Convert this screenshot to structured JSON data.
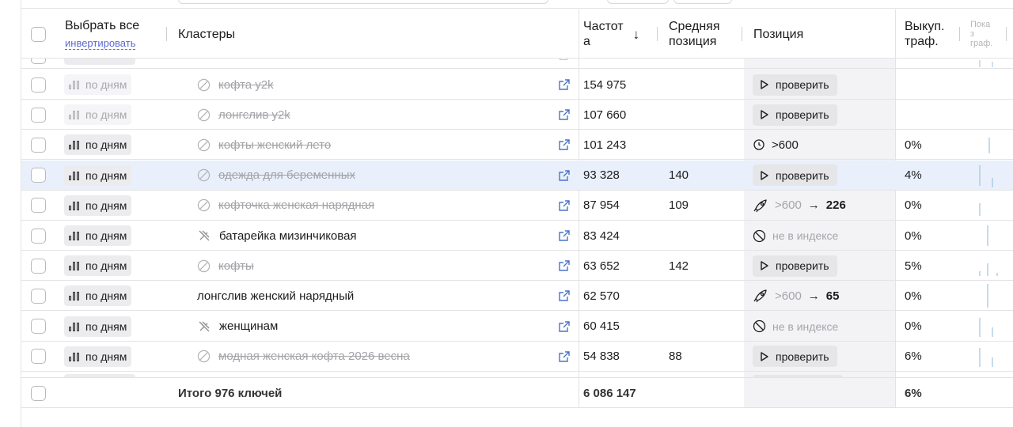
{
  "header": {
    "select_all": "Выбрать все",
    "invert": "инвертировать",
    "clusters": "Кластеры",
    "frequency_line1": "Частот",
    "frequency_line2": "а",
    "avg_position_line1": "Средняя",
    "avg_position_line2": "позиция",
    "position": "Позиция",
    "buyout_line1": "Выкуп.",
    "buyout_line2": "траф.",
    "shows_line1": "Пока",
    "shows_line2": "з",
    "shows_line3": "граф."
  },
  "days_label": "по дням",
  "check_label": "проверить",
  "rows": [
    {
      "keyword": "кофта y2k",
      "status": "excluded",
      "frequency": "154 975",
      "avg_position": "",
      "position_type": "check",
      "buyout": "",
      "faded_days": true,
      "selected": false
    },
    {
      "keyword": "лонгслив y2k",
      "status": "excluded",
      "frequency": "107 660",
      "avg_position": "",
      "position_type": "check",
      "buyout": "",
      "faded_days": true,
      "selected": false
    },
    {
      "keyword": "кофты женский лето",
      "status": "excluded",
      "frequency": "101 243",
      "avg_position": "",
      "position_type": "timer",
      "position_value": ">600",
      "buyout": "0%",
      "faded_days": false,
      "selected": false
    },
    {
      "keyword": "одежда для беременных",
      "status": "excluded",
      "frequency": "93 328",
      "avg_position": "140",
      "position_type": "check",
      "buyout": "4%",
      "faded_days": false,
      "selected": true
    },
    {
      "keyword": "кофточка женская нарядная",
      "status": "excluded",
      "frequency": "87 954",
      "avg_position": "109",
      "position_type": "rocket",
      "position_from": ">600",
      "position_to": "226",
      "buyout": "0%",
      "faded_days": false,
      "selected": false
    },
    {
      "keyword": "батарейка мизинчиковая",
      "status": "unpinned",
      "frequency": "83 424",
      "avg_position": "",
      "position_type": "noindex",
      "position_value": "не в индексе",
      "buyout": "0%",
      "faded_days": false,
      "selected": false
    },
    {
      "keyword": "кофты",
      "status": "excluded",
      "frequency": "63 652",
      "avg_position": "142",
      "position_type": "check",
      "buyout": "5%",
      "faded_days": false,
      "selected": false
    },
    {
      "keyword": "лонгслив женский нарядный",
      "status": "normal",
      "frequency": "62 570",
      "avg_position": "",
      "position_type": "rocket",
      "position_from": ">600",
      "position_to": "65",
      "buyout": "0%",
      "faded_days": false,
      "selected": false
    },
    {
      "keyword": "женщинам",
      "status": "unpinned",
      "frequency": "60 415",
      "avg_position": "",
      "position_type": "noindex",
      "position_value": "не в индексе",
      "buyout": "0%",
      "faded_days": false,
      "selected": false
    },
    {
      "keyword": "модная женская кофта 2026 весна",
      "status": "excluded",
      "frequency": "54 838",
      "avg_position": "88",
      "position_type": "check",
      "buyout": "6%",
      "faded_days": false,
      "selected": false
    }
  ],
  "total": {
    "label": "Итого 976 ключей",
    "frequency": "6 086 147",
    "buyout": "6%"
  },
  "colors": {
    "accent_link": "#5b6ad0",
    "ext_icon": "#4a73c8",
    "selected_row": "#e9f0fb",
    "sparkline": "#9fc3e0"
  }
}
